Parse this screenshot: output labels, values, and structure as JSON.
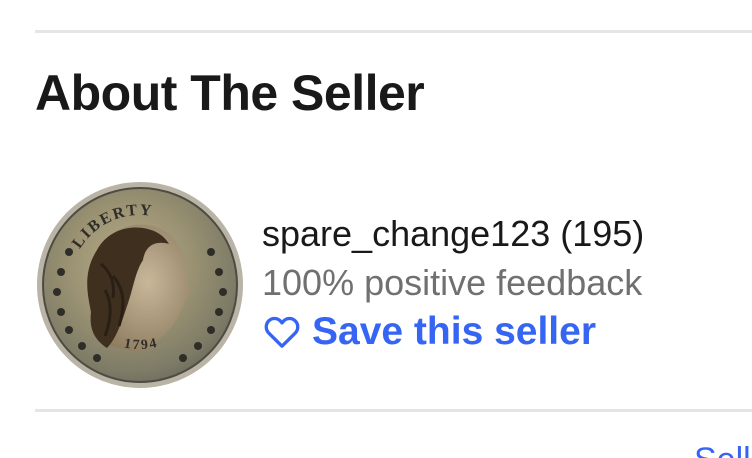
{
  "section": {
    "title": "About The Seller"
  },
  "seller": {
    "avatar_icon": "liberty-coin-image",
    "avatar_text": "LIBERTY",
    "avatar_year": "1794",
    "name": "spare_change123 (195)",
    "feedback": "100% positive feedback",
    "save_label": "Save this seller",
    "save_icon": "heart-outline-icon"
  },
  "footer": {
    "cutoff_link": "Sell"
  },
  "colors": {
    "link": "#3665f3",
    "secondary_text": "#707070",
    "primary_text": "#191919",
    "divider": "#e5e5e5"
  }
}
